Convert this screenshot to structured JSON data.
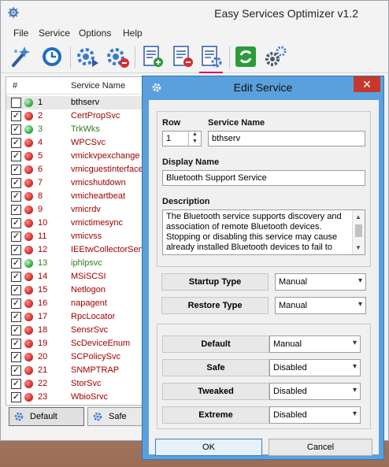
{
  "window": {
    "title": "Easy Services Optimizer v1.2",
    "menu": [
      "File",
      "Service",
      "Options",
      "Help"
    ]
  },
  "list": {
    "header_num": "#",
    "header_name": "Service Name",
    "rows": [
      {
        "num": "1",
        "name": "bthserv",
        "checked": false,
        "status": "green",
        "color": "black"
      },
      {
        "num": "2",
        "name": "CertPropSvc",
        "checked": true,
        "status": "red",
        "color": "red"
      },
      {
        "num": "3",
        "name": "TrkWks",
        "checked": true,
        "status": "green",
        "color": "green"
      },
      {
        "num": "4",
        "name": "WPCSvc",
        "checked": true,
        "status": "red",
        "color": "red"
      },
      {
        "num": "5",
        "name": "vmickvpexchange",
        "checked": true,
        "status": "red",
        "color": "red"
      },
      {
        "num": "6",
        "name": "vmicguestinterface",
        "checked": true,
        "status": "red",
        "color": "red"
      },
      {
        "num": "7",
        "name": "vmicshutdown",
        "checked": true,
        "status": "red",
        "color": "red"
      },
      {
        "num": "8",
        "name": "vmicheartbeat",
        "checked": true,
        "status": "red",
        "color": "red"
      },
      {
        "num": "9",
        "name": "vmicrdv",
        "checked": true,
        "status": "red",
        "color": "red"
      },
      {
        "num": "10",
        "name": "vmictimesync",
        "checked": true,
        "status": "red",
        "color": "red"
      },
      {
        "num": "11",
        "name": "vmicvss",
        "checked": true,
        "status": "red",
        "color": "red"
      },
      {
        "num": "12",
        "name": "IEEtwCollectorService",
        "checked": true,
        "status": "red",
        "color": "red"
      },
      {
        "num": "13",
        "name": "iphlpsvc",
        "checked": true,
        "status": "green",
        "color": "green"
      },
      {
        "num": "14",
        "name": "MSiSCSI",
        "checked": true,
        "status": "red",
        "color": "red"
      },
      {
        "num": "15",
        "name": "Netlogon",
        "checked": true,
        "status": "red",
        "color": "red"
      },
      {
        "num": "16",
        "name": "napagent",
        "checked": true,
        "status": "red",
        "color": "red"
      },
      {
        "num": "17",
        "name": "RpcLocator",
        "checked": true,
        "status": "red",
        "color": "red"
      },
      {
        "num": "18",
        "name": "SensrSvc",
        "checked": true,
        "status": "red",
        "color": "red"
      },
      {
        "num": "19",
        "name": "ScDeviceEnum",
        "checked": true,
        "status": "red",
        "color": "red"
      },
      {
        "num": "20",
        "name": "SCPolicySvc",
        "checked": true,
        "status": "red",
        "color": "red"
      },
      {
        "num": "21",
        "name": "SNMPTRAP",
        "checked": true,
        "status": "red",
        "color": "red"
      },
      {
        "num": "22",
        "name": "StorSvc",
        "checked": true,
        "status": "red",
        "color": "red"
      },
      {
        "num": "23",
        "name": "WbioSrvc",
        "checked": true,
        "status": "red",
        "color": "red"
      }
    ]
  },
  "bottom": {
    "default_label": "Default",
    "safe_label": "Safe"
  },
  "dialog": {
    "title": "Edit Service",
    "row_label": "Row",
    "row_value": "1",
    "service_name_label": "Service Name",
    "service_name_value": "bthserv",
    "display_name_label": "Display Name",
    "display_name_value": "Bluetooth Support Service",
    "description_label": "Description",
    "description_lines": [
      "The Bluetooth service supports discovery and",
      "association of remote Bluetooth devices.",
      "Stopping or disabling this service may cause",
      "already installed Bluetooth devices to fail to"
    ],
    "startup_type_label": "Startup Type",
    "startup_type_value": "Manual",
    "restore_type_label": "Restore Type",
    "restore_type_value": "Manual",
    "presets": [
      {
        "label": "Default",
        "value": "Manual"
      },
      {
        "label": "Safe",
        "value": "Disabled"
      },
      {
        "label": "Tweaked",
        "value": "Disabled"
      },
      {
        "label": "Extreme",
        "value": "Disabled"
      }
    ],
    "ok_label": "OK",
    "cancel_label": "Cancel"
  },
  "colors": {
    "accent_blue": "#5aa0dc",
    "close_red": "#c7382c",
    "status_red": "#c62828",
    "status_green": "#2e9b3a",
    "active_tool_underline": "#d8007a"
  },
  "icons": {
    "toolbar": [
      "wizard-icon",
      "restore-icon",
      "start-service-icon",
      "stop-service-icon",
      "add-service-icon",
      "remove-service-icon",
      "edit-service-icon",
      "refresh-icon",
      "settings-icon"
    ]
  }
}
